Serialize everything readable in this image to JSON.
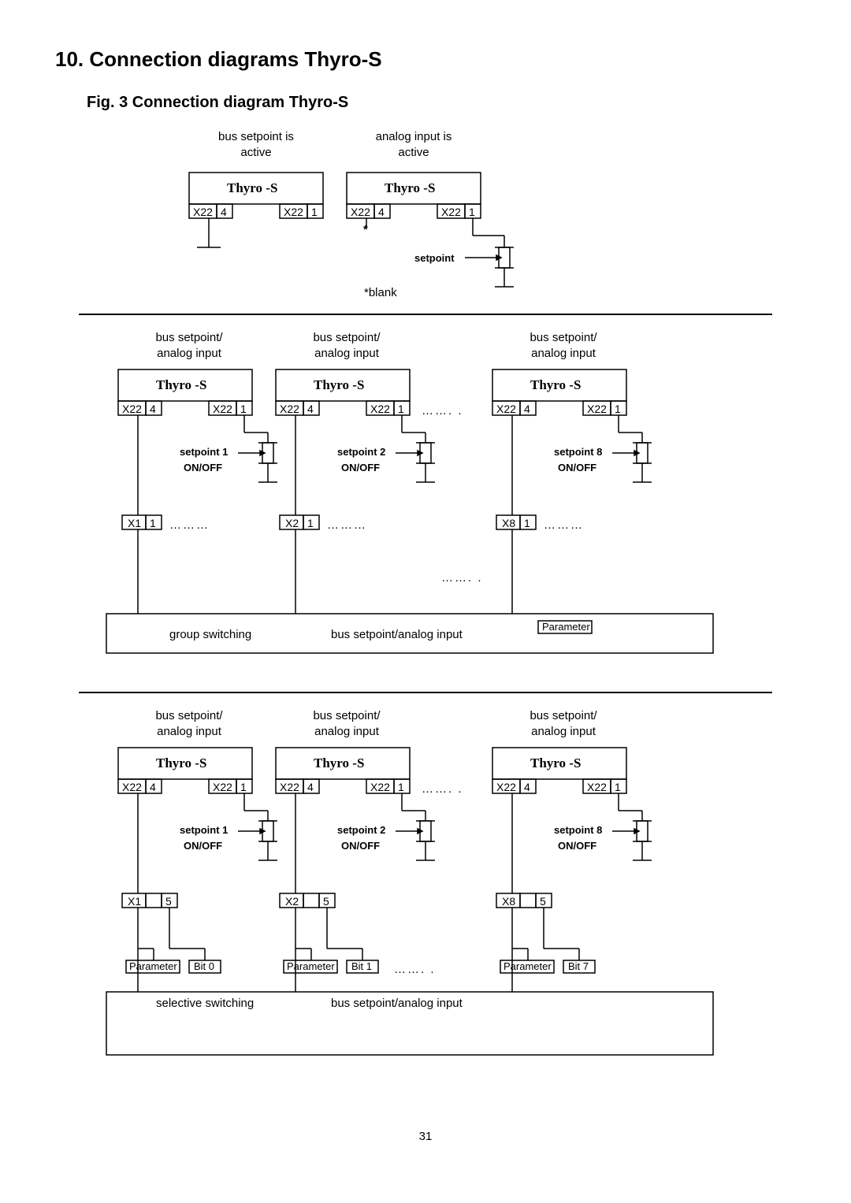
{
  "heading": "10. Connection diagrams Thyro-S",
  "figCaption": "Fig. 3 Connection diagram Thyro-S",
  "pageNumber": "31",
  "labels": {
    "busActive": "bus setpoint is\nactive",
    "analogActive": "analog input is\nactive",
    "device": "Thyro -S",
    "x22": "X22",
    "four": "4",
    "one": "1",
    "five": "5",
    "star": "*",
    "setpoint": "setpoint",
    "blank": "*blank",
    "busAnalog": "bus setpoint/\nanalog input",
    "sp1": "setpoint 1",
    "sp2": "setpoint 2",
    "sp8": "setpoint 8",
    "onoff": "ON/OFF",
    "x1": "X1",
    "x2": "X2",
    "x8": "X8",
    "dots": "………",
    "dotsH": "……. .",
    "groupSw": "group switching",
    "busAnalogLine": "bus setpoint/analog input",
    "param": "Parameter",
    "selSw": "selective switching",
    "bit0": "Bit 0",
    "bit1": "Bit 1",
    "bit7": "Bit 7"
  }
}
